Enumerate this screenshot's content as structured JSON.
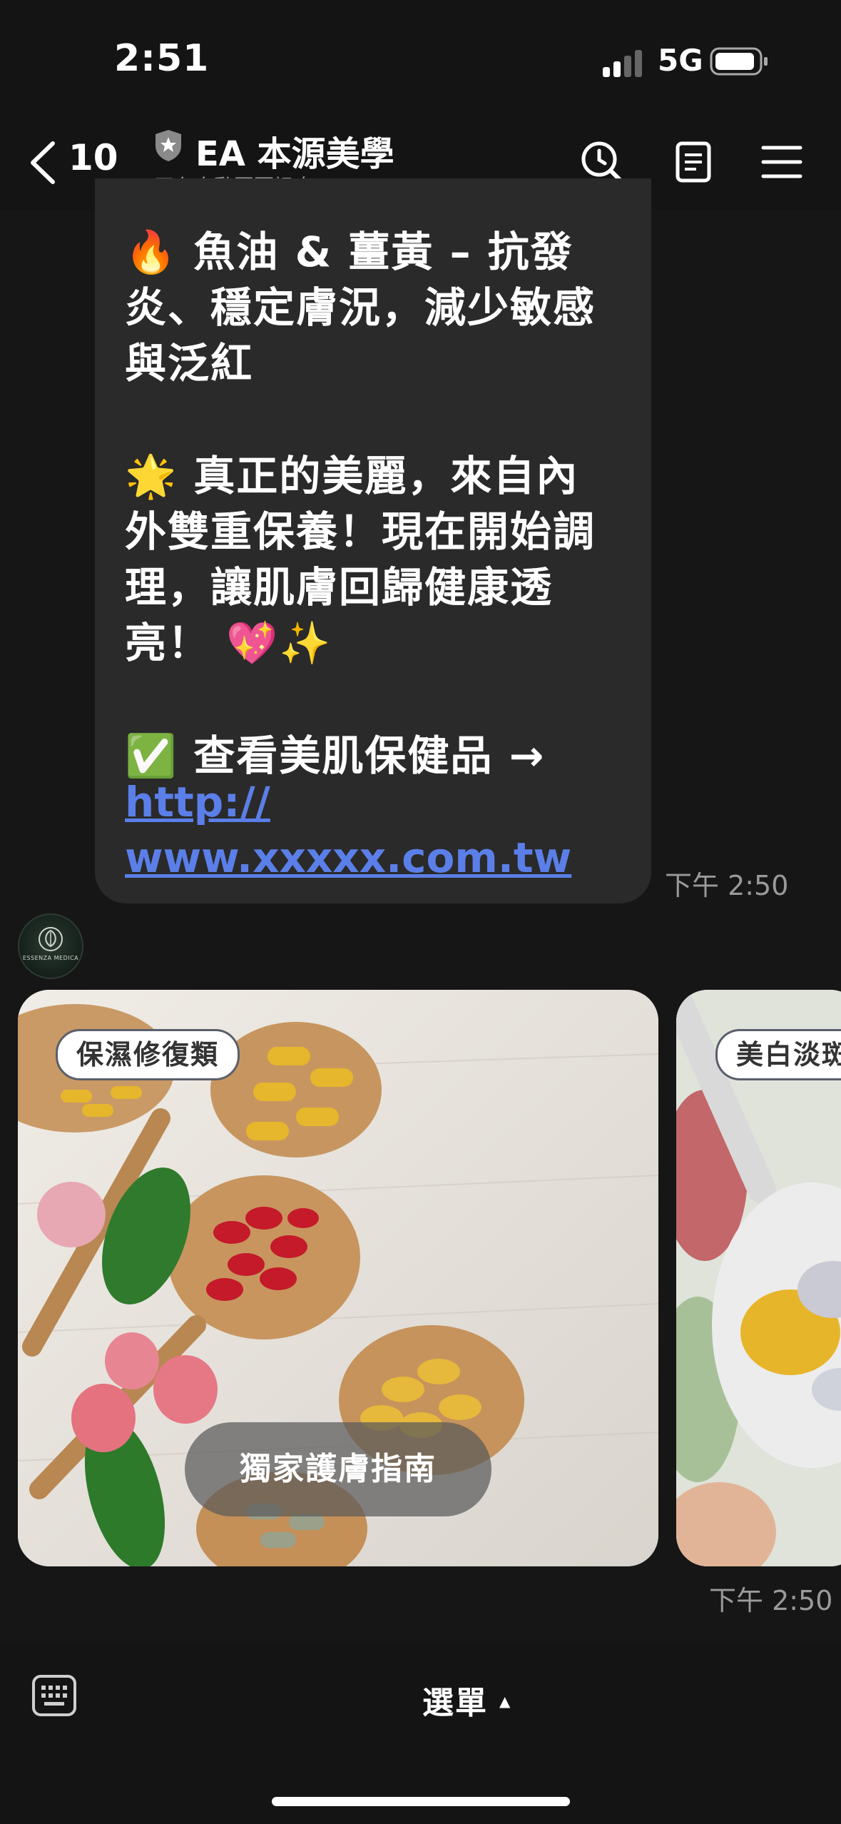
{
  "status_bar": {
    "time": "2:51",
    "network": "5G"
  },
  "header": {
    "unread_count": "10",
    "title": "EA 本源美學",
    "subtitle": "正在自動回覆訊息"
  },
  "message": {
    "lines": [
      "🔥 魚油 & 薑黃 – 抗發",
      "炎、穩定膚況，減少敏感",
      "與泛紅",
      "🌟 真正的美麗，來自內",
      "外雙重保養！現在開始調",
      "理，讓肌膚回歸健康透",
      "亮！ 💖✨",
      "✅ 查看美肌保健品 →"
    ],
    "link_lines": [
      "http://",
      "www.xxxxx.com.tw"
    ],
    "timestamp": "下午 2:50"
  },
  "avatar": {
    "text": "ESSENZA MEDICA"
  },
  "carousel": {
    "cards": [
      {
        "tag": "保濕修復類",
        "button": "獨家護膚指南"
      },
      {
        "tag": "美白淡斑"
      }
    ],
    "timestamp": "下午 2:50"
  },
  "bottom_bar": {
    "menu_label": "選單",
    "menu_caret": "▲"
  },
  "colors": {
    "background": "#161616",
    "bubble": "#2a2a2a",
    "link": "#5b7fe8",
    "timestamp": "#9a9a9a"
  }
}
